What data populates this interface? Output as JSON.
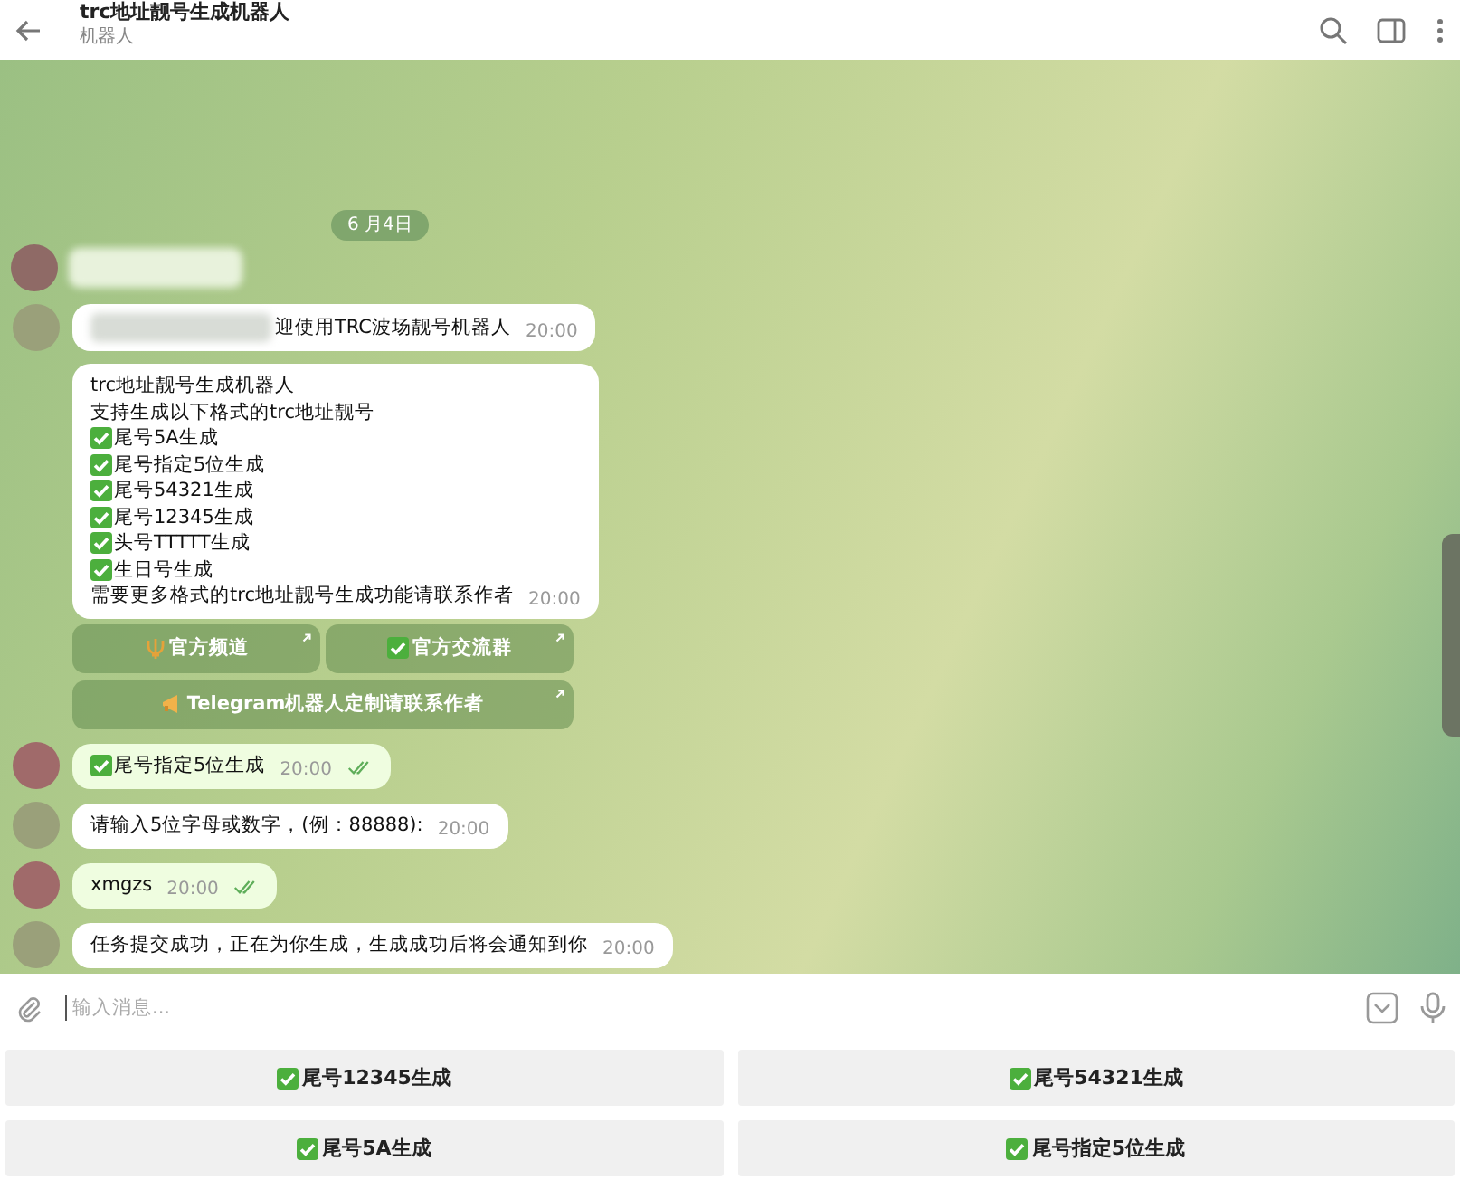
{
  "header": {
    "title": "trc地址靓号生成机器人",
    "subtitle": "机器人"
  },
  "date_pill": "6 月4日",
  "messages": [
    {
      "kind": "redacted",
      "outgoing": false,
      "avatar": true,
      "lines": [
        {
          "text": "迎使用TRC波场靓号机器人",
          "check": false
        }
      ],
      "time": "20:00"
    },
    {
      "kind": "text",
      "outgoing": false,
      "avatar": false,
      "lines": [
        {
          "text": "trc地址靓号生成机器人",
          "check": false
        },
        {
          "text": "支持生成以下格式的trc地址靓号",
          "check": false
        },
        {
          "text": "尾号5A生成",
          "check": true
        },
        {
          "text": "尾号指定5位生成",
          "check": true
        },
        {
          "text": "尾号54321生成",
          "check": true
        },
        {
          "text": "尾号12345生成",
          "check": true
        },
        {
          "text": "头号TTTTT生成",
          "check": true
        },
        {
          "text": "生日号生成",
          "check": true
        },
        {
          "text": "需要更多格式的trc地址靓号生成功能请联系作者",
          "check": false
        }
      ],
      "time": "20:00",
      "inline_buttons": [
        [
          {
            "label": "官方频道"
          },
          {
            "label": "官方交流群"
          }
        ],
        [
          {
            "label": "Telegram机器人定制请联系作者"
          }
        ]
      ]
    },
    {
      "kind": "text",
      "outgoing": true,
      "read": true,
      "avatar": true,
      "lines": [
        {
          "text": "尾号指定5位生成",
          "check": true
        }
      ],
      "time": "20:00"
    },
    {
      "kind": "text",
      "outgoing": false,
      "avatar": true,
      "lines": [
        {
          "text": "请输入5位字母或数字，(例：88888):",
          "check": false
        }
      ],
      "time": "20:00"
    },
    {
      "kind": "text",
      "outgoing": true,
      "read": true,
      "avatar": true,
      "lines": [
        {
          "text": "xmgzs",
          "check": false
        }
      ],
      "time": "20:00"
    },
    {
      "kind": "text",
      "outgoing": false,
      "avatar": true,
      "lines": [
        {
          "text": "任务提交成功，正在为你生成，生成成功后将会通知到你",
          "check": false
        }
      ],
      "time": "20:00"
    }
  ],
  "input": {
    "placeholder": "输入消息..."
  },
  "keyboard": [
    [
      "尾号12345生成",
      "尾号54321生成"
    ],
    [
      "尾号5A生成",
      "尾号指定5位生成"
    ]
  ]
}
